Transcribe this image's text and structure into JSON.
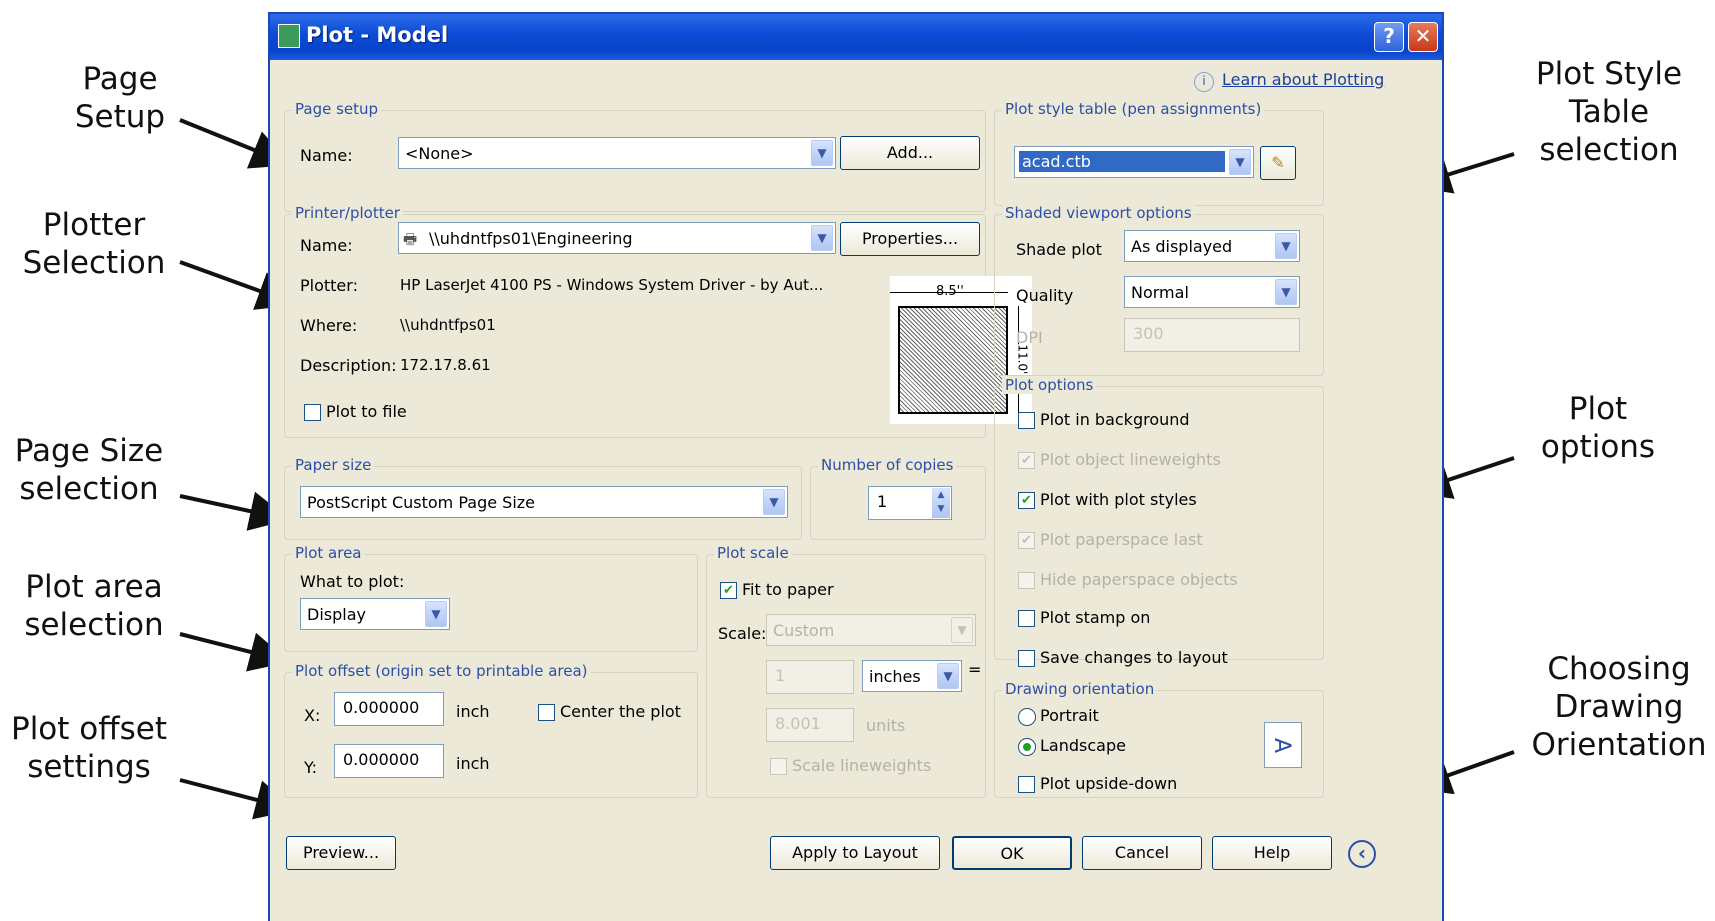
{
  "callouts": {
    "page_setup": [
      "Page",
      "Setup"
    ],
    "plotter_selection": [
      "Plotter",
      "Selection"
    ],
    "page_size": [
      "Page Size",
      "selection"
    ],
    "plot_area": [
      "Plot area",
      "selection"
    ],
    "plot_offset": [
      "Plot offset",
      "settings"
    ],
    "plot_style_table": [
      "Plot Style",
      "Table",
      "selection"
    ],
    "plot_options": [
      "Plot",
      "options"
    ],
    "drawing_orientation": [
      "Choosing",
      "Drawing",
      "Orientation"
    ]
  },
  "dialog": {
    "title": "Plot - Model",
    "help_button": "?",
    "close_button": "✕",
    "learn_link": "Learn about Plotting",
    "info_glyph": "i",
    "page_setup": {
      "group_label": "Page setup",
      "name_label": "Name:",
      "name_value": "<None>",
      "add_button": "Add..."
    },
    "printer": {
      "group_label": "Printer/plotter",
      "name_label": "Name:",
      "name_value": "\\\\uhdntfps01\\Engineering",
      "properties_button": "Properties...",
      "plotter_label": "Plotter:",
      "plotter_value": "HP LaserJet 4100 PS - Windows System Driver - by Aut...",
      "where_label": "Where:",
      "where_value": "\\\\uhdntfps01",
      "description_label": "Description:",
      "description_value": "172.17.8.61",
      "plot_to_file": "Plot to file",
      "plot_to_file_checked": false,
      "preview_width_label": "8.5''",
      "preview_height_label": "11.0''"
    },
    "paper_size": {
      "group_label": "Paper size",
      "value": "PostScript Custom Page Size"
    },
    "copies": {
      "group_label": "Number of copies",
      "value": "1"
    },
    "plot_area": {
      "group_label": "Plot area",
      "what_label": "What to plot:",
      "value": "Display"
    },
    "plot_scale": {
      "group_label": "Plot scale",
      "fit_to_paper": "Fit to paper",
      "fit_checked": true,
      "scale_label": "Scale:",
      "scale_value": "Custom",
      "units_value_1": "1",
      "units_select": "inches",
      "equals": "=",
      "units_value_2": "8.001",
      "units_label_2": "units",
      "scale_lineweights": "Scale lineweights"
    },
    "plot_offset": {
      "group_label": "Plot offset (origin set to printable area)",
      "x_label": "X:",
      "x_value": "0.000000",
      "y_label": "Y:",
      "y_value": "0.000000",
      "unit": "inch",
      "center_label": "Center the plot",
      "center_checked": false
    },
    "plot_style_table": {
      "group_label": "Plot style table (pen assignments)",
      "value": "acad.ctb",
      "edit_icon": "✎"
    },
    "shaded_viewport": {
      "group_label": "Shaded viewport options",
      "shade_label": "Shade plot",
      "shade_value": "As displayed",
      "quality_label": "Quality",
      "quality_value": "Normal",
      "dpi_label": "DPI",
      "dpi_value": "300"
    },
    "plot_options": {
      "group_label": "Plot options",
      "items": [
        {
          "label": "Plot in background",
          "checked": false,
          "enabled": true
        },
        {
          "label": "Plot object lineweights",
          "checked": true,
          "enabled": false
        },
        {
          "label": "Plot with plot styles",
          "checked": true,
          "enabled": true
        },
        {
          "label": "Plot paperspace last",
          "checked": true,
          "enabled": false
        },
        {
          "label": "Hide paperspace objects",
          "checked": false,
          "enabled": false
        },
        {
          "label": "Plot stamp on",
          "checked": false,
          "enabled": true
        },
        {
          "label": "Save changes to layout",
          "checked": false,
          "enabled": true
        }
      ]
    },
    "orientation": {
      "group_label": "Drawing orientation",
      "portrait": "Portrait",
      "landscape": "Landscape",
      "selected": "Landscape",
      "upside_down": "Plot upside-down",
      "orientation_icon": "A"
    },
    "footer": {
      "preview_button": "Preview...",
      "apply_button": "Apply to Layout",
      "ok_button": "OK",
      "cancel_button": "Cancel",
      "help_button": "Help",
      "collapse_icon": "‹"
    }
  }
}
